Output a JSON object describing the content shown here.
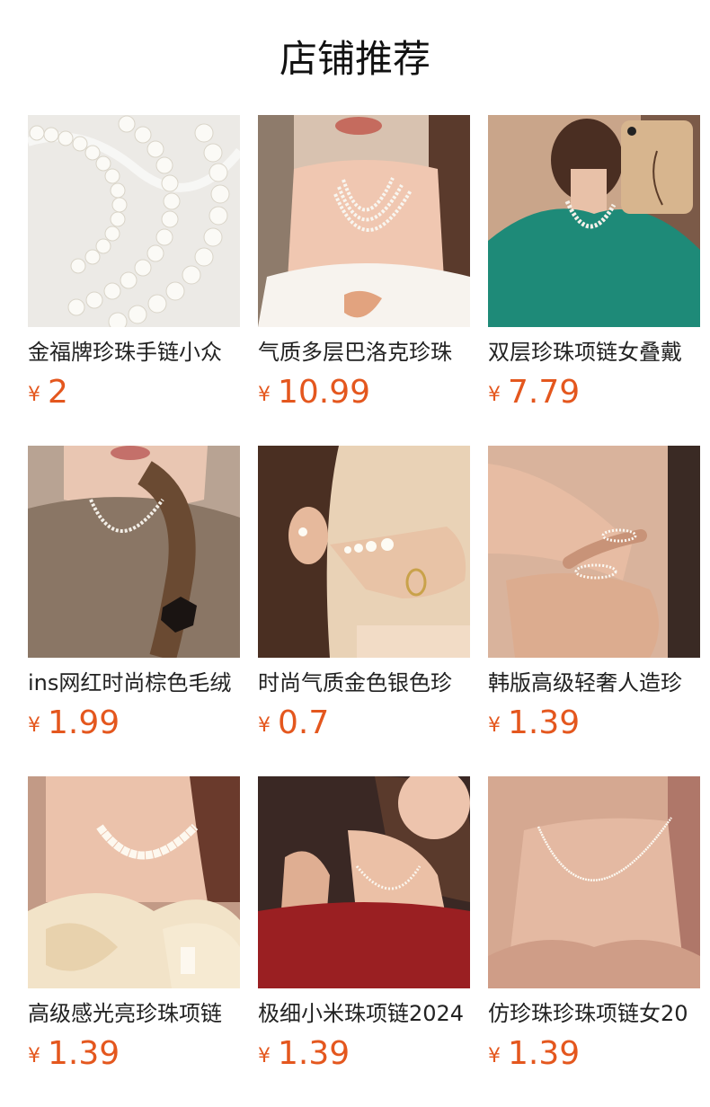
{
  "section_title": "店铺推荐",
  "currency_symbol": "¥",
  "products": [
    {
      "name": "金福牌珍珠手链小众",
      "price": "2"
    },
    {
      "name": "气质多层巴洛克珍珠",
      "price": "10.99"
    },
    {
      "name": "双层珍珠项链女叠戴",
      "price": "7.79"
    },
    {
      "name": "ins网红时尚棕色毛绒",
      "price": "1.99"
    },
    {
      "name": "时尚气质金色银色珍",
      "price": "0.7"
    },
    {
      "name": "韩版高级轻奢人造珍",
      "price": "1.39"
    },
    {
      "name": "高级感光亮珍珠项链",
      "price": "1.39"
    },
    {
      "name": "极细小米珠项链2024",
      "price": "1.39"
    },
    {
      "name": "仿珍珠珍珠项链女20",
      "price": "1.39"
    }
  ],
  "colors": {
    "price": "#e4571e",
    "title": "#111111",
    "name": "#222222"
  }
}
